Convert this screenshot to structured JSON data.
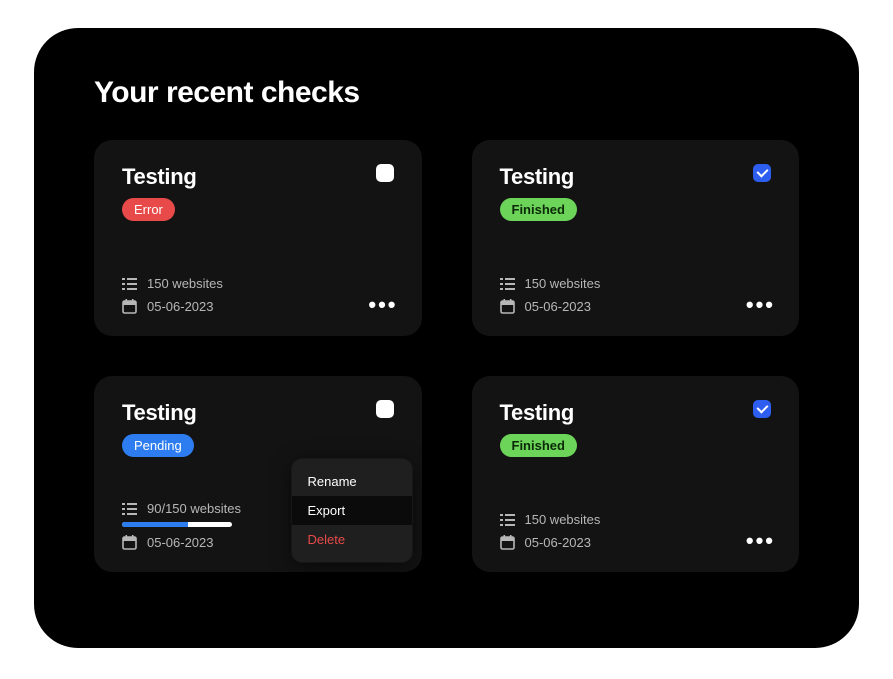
{
  "page_title": "Your recent checks",
  "status_labels": {
    "error": "Error",
    "finished": "Finished",
    "pending": "Pending"
  },
  "cards": [
    {
      "title": "Testing",
      "status": "error",
      "websites": "150 websites",
      "date": "05-06-2023",
      "checked": false,
      "has_progress": false,
      "menu_open": false
    },
    {
      "title": "Testing",
      "status": "finished",
      "websites": "150 websites",
      "date": "05-06-2023",
      "checked": true,
      "has_progress": false,
      "menu_open": false
    },
    {
      "title": "Testing",
      "status": "pending",
      "websites": "90/150 websites",
      "date": "05-06-2023",
      "checked": false,
      "has_progress": true,
      "progress_percent": 60,
      "menu_open": true
    },
    {
      "title": "Testing",
      "status": "finished",
      "websites": "150 websites",
      "date": "05-06-2023",
      "checked": true,
      "has_progress": false,
      "menu_open": false
    }
  ],
  "context_menu": {
    "rename": "Rename",
    "export": "Export",
    "delete": "Delete"
  },
  "colors": {
    "error": "#e84a4a",
    "finished": "#6dd45a",
    "pending": "#2d7df0",
    "card_bg": "#131313",
    "panel_bg": "#000000"
  }
}
